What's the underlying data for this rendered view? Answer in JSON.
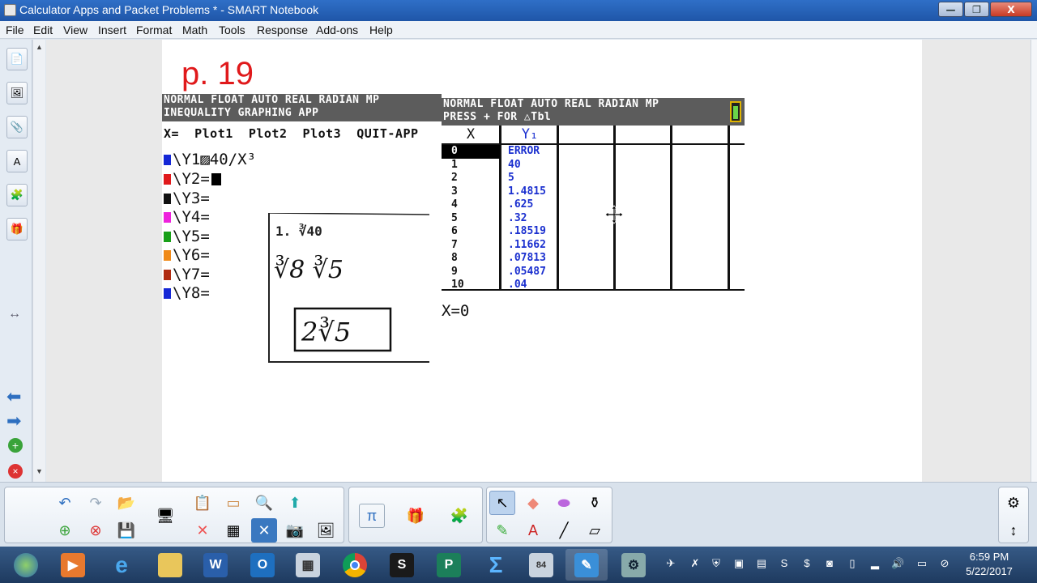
{
  "window": {
    "title": "Calculator Apps and Packet Problems * - SMART Notebook",
    "min_label": "—",
    "max_label": "❐",
    "close_label": "X"
  },
  "menu": [
    "File",
    "Edit",
    "View",
    "Insert",
    "Format",
    "Math",
    "Tools",
    "Response",
    "Add-ons",
    "Help"
  ],
  "page": {
    "label": "p. 19"
  },
  "calc1": {
    "status_line1": "NORMAL FLOAT AUTO REAL RADIAN MP",
    "status_line2": "INEQUALITY GRAPHING APP",
    "plot_row": "X=  Plot1  Plot2  Plot3  QUIT-APP",
    "y_rows": [
      {
        "name": "Y1",
        "text": "\\Y1▨40/X³",
        "color": "#1427d6"
      },
      {
        "name": "Y2",
        "text": "\\Y2=",
        "color": "#e0191b"
      },
      {
        "name": "Y3",
        "text": "\\Y3=",
        "color": "#111111"
      },
      {
        "name": "Y4",
        "text": "\\Y4=",
        "color": "#ee22dd"
      },
      {
        "name": "Y5",
        "text": "\\Y5=",
        "color": "#18a018"
      },
      {
        "name": "Y6",
        "text": "\\Y6=",
        "color": "#f08a18"
      },
      {
        "name": "Y7",
        "text": "\\Y7=",
        "color": "#b02a10"
      },
      {
        "name": "Y8",
        "text": "\\Y8=",
        "color": "#1427d6"
      }
    ]
  },
  "handwriting": {
    "problem": "1. ∛40",
    "step": "∛8 ∛5",
    "answer": "2∛5"
  },
  "calc2": {
    "status_line1": "NORMAL FLOAT AUTO REAL RADIAN MP",
    "status_line2": "PRESS + FOR △Tbl",
    "col_x": "X",
    "col_y": "Y₁",
    "rows": [
      {
        "x": "0",
        "y": "ERROR"
      },
      {
        "x": "1",
        "y": "40"
      },
      {
        "x": "2",
        "y": "5"
      },
      {
        "x": "3",
        "y": "1.4815"
      },
      {
        "x": "4",
        "y": ".625"
      },
      {
        "x": "5",
        "y": ".32"
      },
      {
        "x": "6",
        "y": ".18519"
      },
      {
        "x": "7",
        "y": ".11662"
      },
      {
        "x": "8",
        "y": ".07813"
      },
      {
        "x": "9",
        "y": ".05487"
      },
      {
        "x": "10",
        "y": ".04"
      }
    ],
    "footer": "X=0"
  },
  "taskbar": {
    "time": "6:59 PM",
    "date": "5/22/2017"
  }
}
